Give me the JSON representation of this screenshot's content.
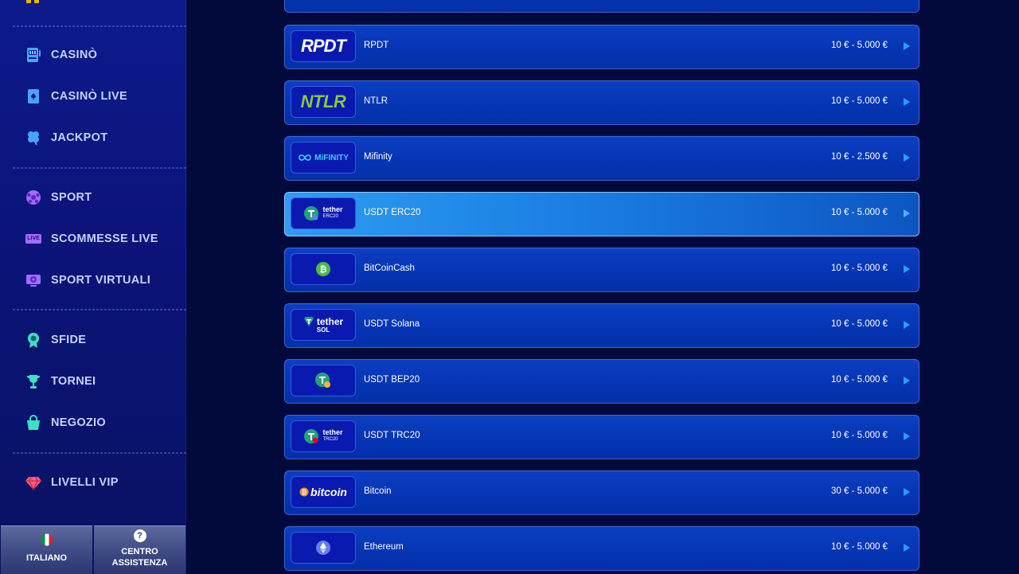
{
  "sidebar": {
    "nav": [
      {
        "id": "casino",
        "label": "CASINÒ",
        "icon": "slot-machine-icon"
      },
      {
        "id": "casino-live",
        "label": "CASINÒ LIVE",
        "icon": "playing-card-icon"
      },
      {
        "id": "jackpot",
        "label": "JACKPOT",
        "icon": "clover-icon"
      },
      {
        "id": "sport",
        "label": "SPORT",
        "icon": "soccer-ball-icon"
      },
      {
        "id": "scommesse-live",
        "label": "SCOMMESSE LIVE",
        "icon": "live-badge-icon",
        "badge": "LIVE"
      },
      {
        "id": "sport-virtuali",
        "label": "SPORT VIRTUALI",
        "icon": "virtual-sport-icon"
      },
      {
        "id": "sfide",
        "label": "SFIDE",
        "icon": "medal-icon"
      },
      {
        "id": "tornei",
        "label": "TORNEI",
        "icon": "trophy-icon"
      },
      {
        "id": "negozio",
        "label": "NEGOZIO",
        "icon": "shopping-bag-icon"
      },
      {
        "id": "livelli-vip",
        "label": "LIVELLI VIP",
        "icon": "diamond-icon"
      }
    ],
    "language_button": {
      "label": "ITALIANO",
      "icon": "italy-flag-icon"
    },
    "help_button": {
      "label": "CENTRO ASSISTENZA",
      "icon": "question-icon",
      "icon_text": "?"
    }
  },
  "payment_methods": [
    {
      "name": "RPDT",
      "limits": "10 € - 5.000 €",
      "logo_text": "RPDT",
      "active": false
    },
    {
      "name": "NTLR",
      "limits": "10 € - 5.000 €",
      "logo_text": "NTLR",
      "active": false
    },
    {
      "name": "Mifinity",
      "limits": "10 € - 2.500 €",
      "logo_text": "MiFINITY",
      "active": false
    },
    {
      "name": "USDT ERC20",
      "limits": "10 € - 5.000 €",
      "logo_text": "tether",
      "logo_sub": "ERC20",
      "active": true
    },
    {
      "name": "BitCoinCash",
      "limits": "10 € - 5.000 €",
      "logo_text": "",
      "active": false
    },
    {
      "name": "USDT Solana",
      "limits": "10 € - 5.000 €",
      "logo_text": "tether",
      "logo_sub": "SOL",
      "active": false
    },
    {
      "name": "USDT BEP20",
      "limits": "10 € - 5.000 €",
      "logo_text": "",
      "active": false
    },
    {
      "name": "USDT TRC20",
      "limits": "10 € - 5.000 €",
      "logo_text": "tether",
      "logo_sub": "TRC20",
      "active": false
    },
    {
      "name": "Bitcoin",
      "limits": "30 € - 5.000 €",
      "logo_text": "bitcoin",
      "active": false
    },
    {
      "name": "Ethereum",
      "limits": "10 € - 5.000 €",
      "logo_text": "",
      "active": false
    }
  ],
  "colors": {
    "background": "#020a3c",
    "sidebar": "#0d1a8c",
    "row": "#0636b5",
    "row_active": "#1b7fe3",
    "accent_arrow": "#2aa0ff",
    "tether_green": "#26a17b",
    "bitcoin_orange": "#f7931a",
    "ntlr_green": "#8dc63f"
  }
}
